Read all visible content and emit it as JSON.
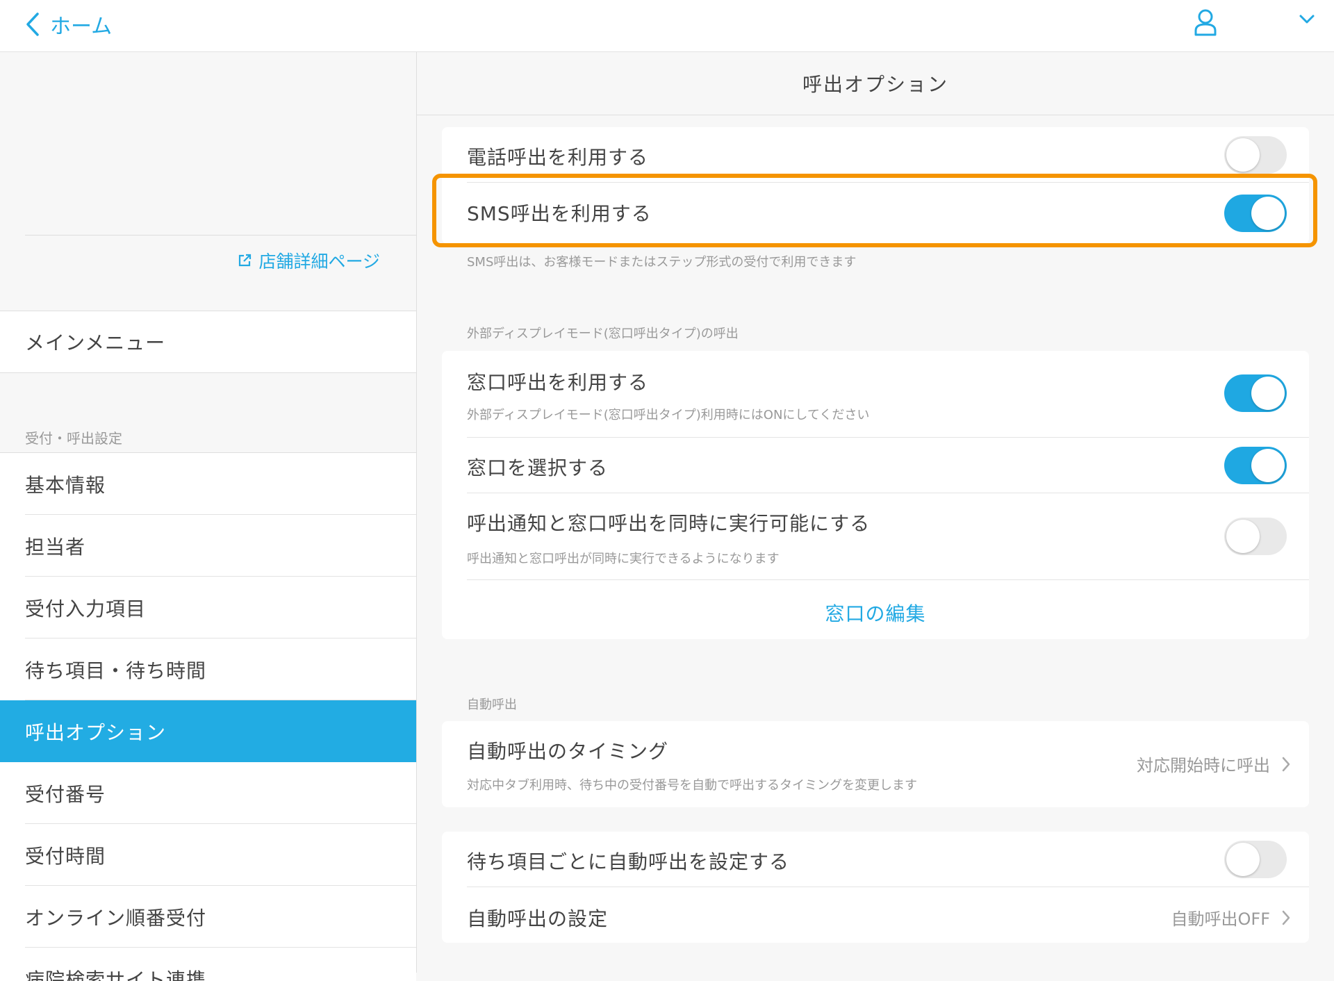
{
  "header": {
    "back_label": "ホーム",
    "back_icon": "chevron-left-icon",
    "user_icon": "user-icon",
    "menu_icon": "chevron-down-icon"
  },
  "sidebar": {
    "store_link": "店舗詳細ページ",
    "main_menu": "メインメニュー",
    "section_label": "受付・呼出設定",
    "items": [
      {
        "label": "基本情報",
        "active": false
      },
      {
        "label": "担当者",
        "active": false
      },
      {
        "label": "受付入力項目",
        "active": false
      },
      {
        "label": "待ち項目・待ち時間",
        "active": false
      },
      {
        "label": "呼出オプション",
        "active": true
      },
      {
        "label": "受付番号",
        "active": false
      },
      {
        "label": "受付時間",
        "active": false
      },
      {
        "label": "オンライン順番受付",
        "active": false
      },
      {
        "label": "病院検索サイト連携",
        "active": false
      }
    ]
  },
  "content": {
    "title": "呼出オプション",
    "call_card": {
      "phone_call": {
        "label": "電話呼出を利用する",
        "enabled": false
      },
      "sms_call": {
        "label": "SMS呼出を利用する",
        "enabled": true
      }
    },
    "sms_note": "SMS呼出は、お客様モードまたはステップ形式の受付で利用できます",
    "window_section_label": "外部ディスプレイモード(窓口呼出タイプ)の呼出",
    "window_card": {
      "use_window_call": {
        "label": "窓口呼出を利用する",
        "sub": "外部ディスプレイモード(窓口呼出タイプ)利用時にはONにしてください",
        "enabled": true
      },
      "select_window": {
        "label": "窓口を選択する",
        "enabled": true
      },
      "simultaneous": {
        "label": "呼出通知と窓口呼出を同時に実行可能にする",
        "sub": "呼出通知と窓口呼出が同時に実行できるようになります",
        "enabled": false
      },
      "edit_link": "窓口の編集"
    },
    "auto_section_label": "自動呼出",
    "auto_timing": {
      "label": "自動呼出のタイミング",
      "sub": "対応中タブ利用時、待ち中の受付番号を自動で呼出するタイミングを変更します",
      "value": "対応開始時に呼出"
    },
    "auto_card": {
      "per_item": {
        "label": "待ち項目ごとに自動呼出を設定する",
        "enabled": false
      },
      "settings": {
        "label": "自動呼出の設定",
        "value": "自動呼出OFF"
      }
    }
  },
  "colors": {
    "accent": "#22a9e3",
    "active_bg": "#22ace3",
    "highlight": "#f59400",
    "toggle_on": "#1fa8e2",
    "toggle_off": "#e9e9e9"
  }
}
